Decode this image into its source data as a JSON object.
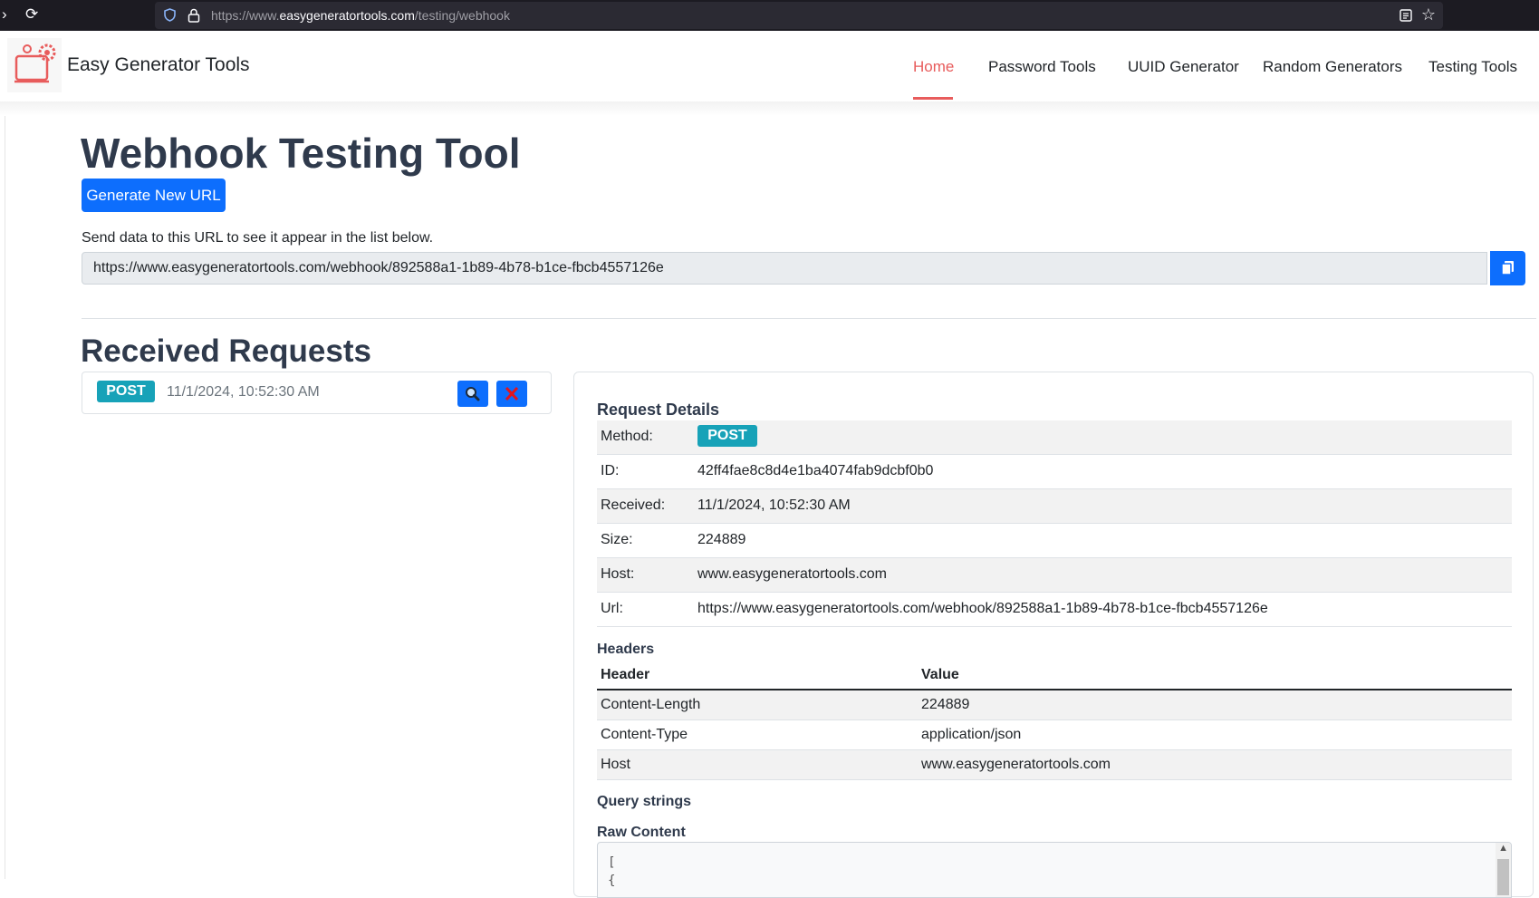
{
  "browser": {
    "url_prefix": "https://www.",
    "url_host": "easygeneratortools.com",
    "url_path": "/testing/webhook"
  },
  "header": {
    "brand": "Easy Generator Tools",
    "nav": [
      {
        "label": "Home",
        "active": true
      },
      {
        "label": "Password Tools"
      },
      {
        "label": "UUID Generator"
      },
      {
        "label": "Random Generators"
      },
      {
        "label": "Testing Tools"
      }
    ]
  },
  "main": {
    "title": "Webhook Testing Tool",
    "generate_button": "Generate New URL",
    "help_text": "Send data to this URL to see it appear in the list below.",
    "webhook_url": "https://www.easygeneratortools.com/webhook/892588a1-1b89-4b78-b1ce-fbcb4557126e",
    "requests_title": "Received Requests"
  },
  "requests": [
    {
      "method": "POST",
      "time": "11/1/2024, 10:52:30 AM"
    }
  ],
  "details": {
    "title": "Request Details",
    "rows": [
      {
        "label": "Method:",
        "value": "POST"
      },
      {
        "label": "ID:",
        "value": "42ff4fae8c8d4e1ba4074fab9dcbf0b0"
      },
      {
        "label": "Received:",
        "value": "11/1/2024, 10:52:30 AM"
      },
      {
        "label": "Size:",
        "value": "224889"
      },
      {
        "label": "Host:",
        "value": "www.easygeneratortools.com"
      },
      {
        "label": "Url:",
        "value": "https://www.easygeneratortools.com/webhook/892588a1-1b89-4b78-b1ce-fbcb4557126e"
      }
    ],
    "headers_title": "Headers",
    "headers_columns": [
      "Header",
      "Value"
    ],
    "headers": [
      {
        "name": "Content-Length",
        "value": "224889"
      },
      {
        "name": "Content-Type",
        "value": "application/json"
      },
      {
        "name": "Host",
        "value": "www.easygeneratortools.com"
      }
    ],
    "query_title": "Query strings",
    "raw_title": "Raw Content",
    "raw_lines": [
      "[",
      "  {"
    ]
  },
  "colors": {
    "primary": "#0d6efd",
    "badge": "#17a2b8",
    "active_nav": "#e85c5c",
    "heading": "#2f3a4c"
  }
}
